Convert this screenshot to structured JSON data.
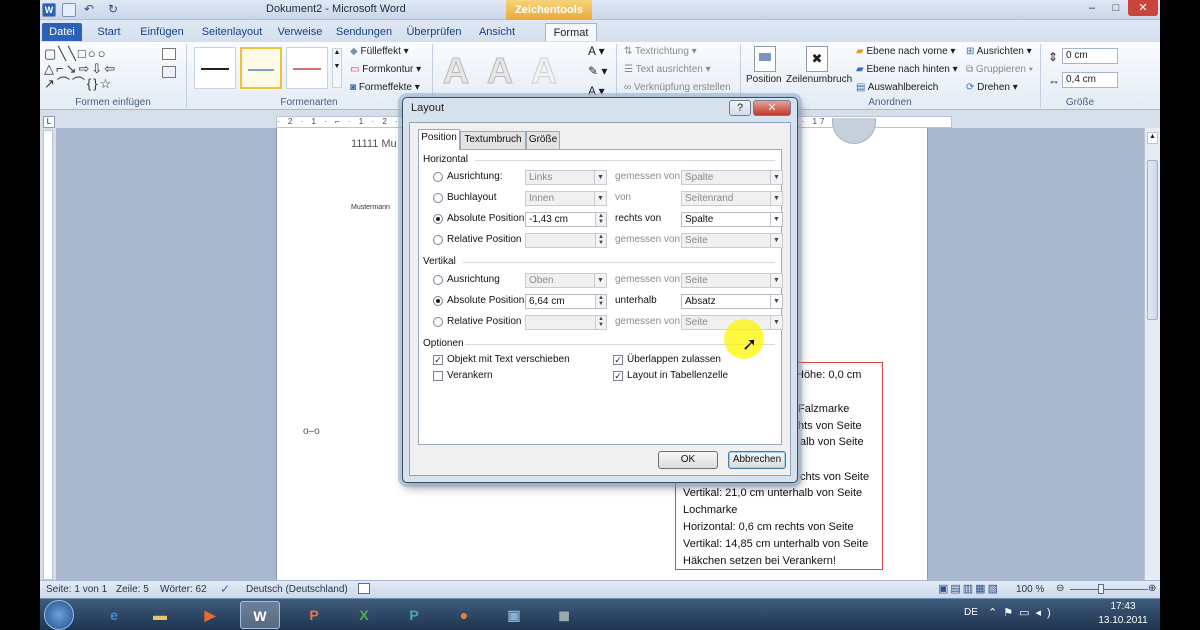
{
  "window": {
    "title": "Dokument2 - Microsoft Word",
    "contextual_tab": "Zeichentools"
  },
  "tabs": [
    "Datei",
    "Start",
    "Einfügen",
    "Seitenlayout",
    "Verweise",
    "Sendungen",
    "Überprüfen",
    "Ansicht",
    "Format"
  ],
  "ribbon": {
    "groups": {
      "shapes_insert": "Formen einfügen",
      "shape_styles": "Formenarten",
      "arrange": "Anordnen",
      "size": "Größe"
    },
    "shape_style_commands": [
      "Fülleffekt",
      "Formkontur",
      "Formeffekte"
    ],
    "text_commands": [
      "Textrichtung",
      "Text ausrichten",
      "Verknüpfung erstellen"
    ],
    "position_label": "Position",
    "wrap_label": "Zeilenumbruch",
    "arrange_commands": [
      "Ebene nach vorne",
      "Ebene nach hinten",
      "Auswahlbereich",
      "Ausrichten",
      "Gruppieren",
      "Drehen"
    ],
    "height_value": "0 cm",
    "width_value": "0,4 cm"
  },
  "ruler": {
    "text": "· 2 · 1 · ⌐ · 1 · 2 · 3 · 4 · 5 · 6 · 7 · 8 · 9 · 10 · 11 · 12 · 13 · 14 · 15 · 16 · △ · 17 · 18 ·"
  },
  "document": {
    "line1": "11111  Mu",
    "line2": "Mustermann",
    "redbox_lines": [
      "Höhe: 0,0 cm",
      "",
      "Falzmarke",
      "hts von Seite",
      "alb von Seite",
      "",
      "chts von Seite",
      "Vertikal: 21,0  cm unterhalb von Seite",
      "Lochmarke",
      "Horizontal: 0,6 cm rechts von Seite",
      "Vertikal: 14,85  cm unterhalb von Seite",
      "Häkchen setzen bei Verankern!"
    ]
  },
  "dialog": {
    "title": "Layout",
    "help": "?",
    "close": "✕",
    "tabs": [
      "Position",
      "Textumbruch",
      "Größe"
    ],
    "active_tab": "Position",
    "horizontal": {
      "title": "Horizontal",
      "rows": [
        {
          "label": "Ausrichtung:",
          "value": "Links",
          "rel_label": "gemessen von",
          "rel_value": "Spalte",
          "selected": false,
          "enabled": false
        },
        {
          "label": "Buchlayout",
          "value": "Innen",
          "rel_label": "von",
          "rel_value": "Seitenrand",
          "selected": false,
          "enabled": false
        },
        {
          "label": "Absolute Position",
          "value": "-1,43 cm",
          "rel_label": "rechts von",
          "rel_value": "Spalte",
          "selected": true,
          "enabled": true
        },
        {
          "label": "Relative Position",
          "value": "",
          "rel_label": "gemessen von",
          "rel_value": "Seite",
          "selected": false,
          "enabled": false
        }
      ]
    },
    "vertical": {
      "title": "Vertikal",
      "rows": [
        {
          "label": "Ausrichtung",
          "value": "Oben",
          "rel_label": "gemessen von",
          "rel_value": "Seite",
          "selected": false,
          "enabled": false
        },
        {
          "label": "Absolute Position",
          "value": "6,64 cm",
          "rel_label": "unterhalb",
          "rel_value": "Absatz",
          "selected": true,
          "enabled": true
        },
        {
          "label": "Relative Position",
          "value": "",
          "rel_label": "gemessen von",
          "rel_value": "Seite",
          "selected": false,
          "enabled": false
        }
      ]
    },
    "options": {
      "title": "Optionen",
      "items": [
        {
          "label": "Objekt mit Text verschieben",
          "checked": true
        },
        {
          "label": "Verankern",
          "checked": false
        },
        {
          "label": "Überlappen zulassen",
          "checked": true
        },
        {
          "label": "Layout in Tabellenzelle",
          "checked": true
        }
      ]
    },
    "ok": "OK",
    "cancel": "Abbrechen"
  },
  "statusbar": {
    "page": "Seite: 1 von 1",
    "line": "Zeile: 5",
    "words": "Wörter: 62",
    "language": "Deutsch (Deutschland)",
    "zoom": "100 %"
  },
  "taskbar": {
    "lang": "DE",
    "time": "17:43",
    "date": "13.10.2011"
  },
  "colors": {
    "accent": "#2a62b8",
    "contextual": "#e8a93b",
    "highlight": "#fff500"
  }
}
